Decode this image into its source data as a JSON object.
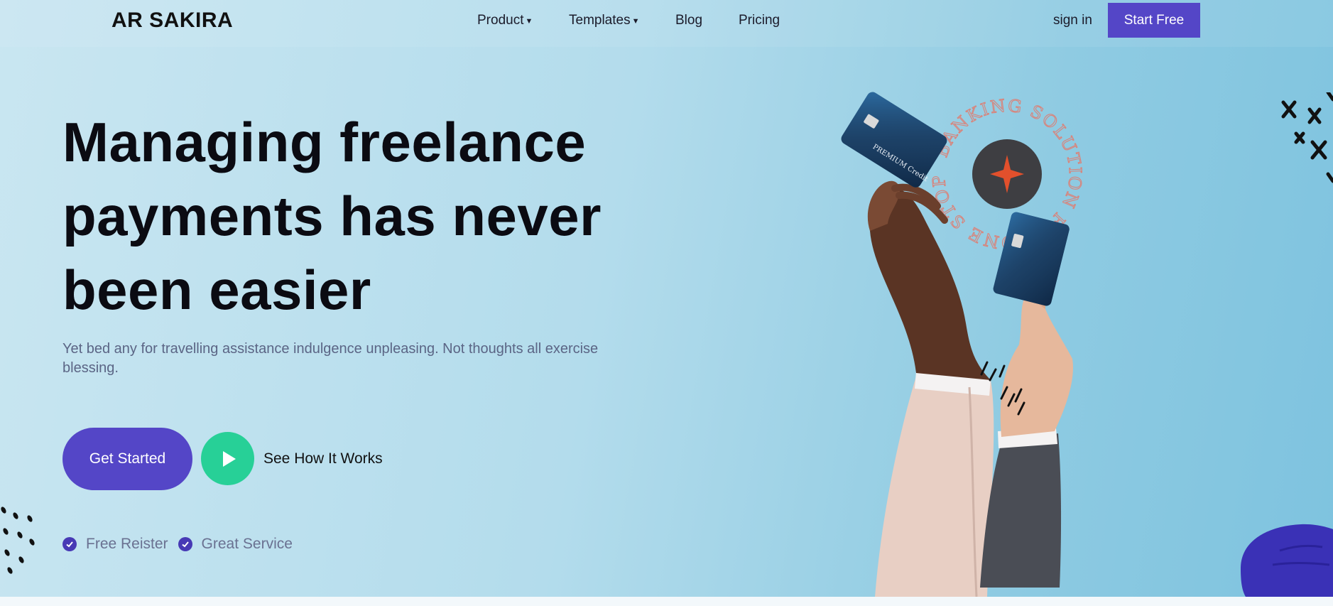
{
  "header": {
    "logo": "AR SAKIRA",
    "nav": [
      {
        "label": "Product",
        "has_dropdown": true
      },
      {
        "label": "Templates",
        "has_dropdown": true
      },
      {
        "label": "Blog",
        "has_dropdown": false
      },
      {
        "label": "Pricing",
        "has_dropdown": false
      }
    ],
    "sign_in": "sign in",
    "start_free": "Start Free"
  },
  "hero": {
    "headline": "Managing freelance payments has never been easier",
    "subtitle": "Yet bed any for travelling assistance indulgence unpleasing. Not thoughts all exercise blessing.",
    "primary_cta": "Get Started",
    "secondary_cta": "See How It Works",
    "features": [
      "Free Reister",
      "Great Service"
    ]
  },
  "illustration": {
    "badge_text": "BANKING SOLUTION FOR ONE STOP",
    "card_label": "PREMIUM Credit",
    "icons": [
      "credit-card-icon",
      "star-icon",
      "play-icon",
      "check-icon"
    ]
  },
  "colors": {
    "accent": "#5446c7",
    "play_button": "#27d097",
    "check": "#4739b5",
    "star": "#e2502c"
  }
}
